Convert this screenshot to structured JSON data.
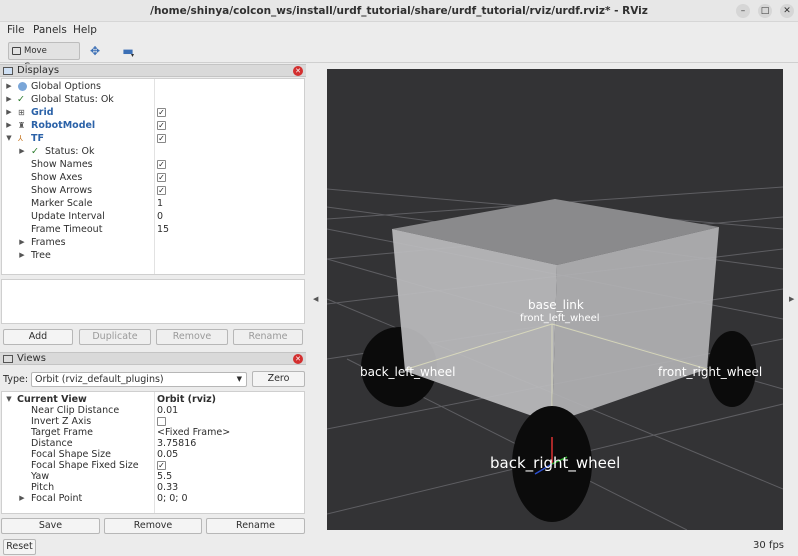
{
  "window": {
    "title": "/home/shinya/colcon_ws/install/urdf_tutorial/share/urdf_tutorial/rviz/urdf.rviz* - RViz"
  },
  "menu": [
    "File",
    "Panels",
    "Help"
  ],
  "toolbar": {
    "move_camera": "Move Camera"
  },
  "displays": {
    "title": "Displays",
    "rows": [
      {
        "label": "Global Options"
      },
      {
        "label": "Global Status: Ok"
      },
      {
        "label": "Grid",
        "checked": "✓"
      },
      {
        "label": "RobotModel",
        "checked": "✓"
      },
      {
        "label": "TF",
        "checked": "✓"
      },
      {
        "label": "Status: Ok"
      },
      {
        "label": "Show Names",
        "checked": "✓"
      },
      {
        "label": "Show Axes",
        "checked": "✓"
      },
      {
        "label": "Show Arrows",
        "checked": "✓"
      },
      {
        "label": "Marker Scale",
        "value": "1"
      },
      {
        "label": "Update Interval",
        "value": "0"
      },
      {
        "label": "Frame Timeout",
        "value": "15"
      },
      {
        "label": "Frames"
      },
      {
        "label": "Tree"
      }
    ],
    "buttons": {
      "add": "Add",
      "duplicate": "Duplicate",
      "remove": "Remove",
      "rename": "Rename"
    }
  },
  "views": {
    "title": "Views",
    "type_label": "Type:",
    "type_value": "Orbit (rviz_default_plugins)",
    "zero": "Zero",
    "rows": [
      {
        "label": "Current View",
        "value": "Orbit (rviz)"
      },
      {
        "label": "Near Clip Distance",
        "value": "0.01"
      },
      {
        "label": "Invert Z Axis"
      },
      {
        "label": "Target Frame",
        "value": "<Fixed Frame>"
      },
      {
        "label": "Distance",
        "value": "3.75816"
      },
      {
        "label": "Focal Shape Size",
        "value": "0.05"
      },
      {
        "label": "Focal Shape Fixed Size",
        "checked": "✓"
      },
      {
        "label": "Yaw",
        "value": "5.5"
      },
      {
        "label": "Pitch",
        "value": "0.33"
      },
      {
        "label": "Focal Point",
        "value": "0; 0; 0"
      }
    ],
    "buttons": {
      "save": "Save",
      "remove": "Remove",
      "rename": "Rename"
    }
  },
  "viewport": {
    "frame_labels": {
      "base_link": "base_link",
      "front_left_wheel": "front_left_wheel",
      "back_left_wheel": "back_left_wheel",
      "front_right_wheel": "front_right_wheel",
      "back_right_wheel": "back_right_wheel"
    },
    "background": "#333335"
  },
  "status": {
    "reset": "Reset",
    "fps": "30 fps"
  }
}
